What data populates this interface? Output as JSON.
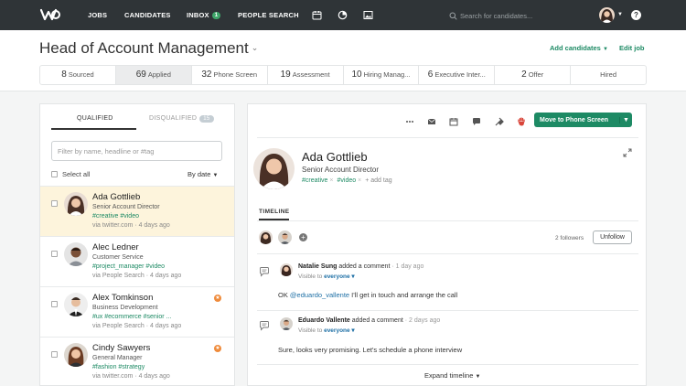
{
  "nav": {
    "items": [
      "JOBS",
      "CANDIDATES",
      "INBOX",
      "PEOPLE SEARCH"
    ],
    "inbox_count": "1",
    "search_placeholder": "Search for candidates..."
  },
  "header": {
    "job_title": "Head of Account Management",
    "add_candidates": "Add candidates",
    "edit_job": "Edit job",
    "stages": [
      {
        "count": "8",
        "label": "Sourced"
      },
      {
        "count": "69",
        "label": "Applied"
      },
      {
        "count": "32",
        "label": "Phone Screen"
      },
      {
        "count": "19",
        "label": "Assessment"
      },
      {
        "count": "10",
        "label": "Hiring Manag..."
      },
      {
        "count": "6",
        "label": "Executive Inter..."
      },
      {
        "count": "2",
        "label": "Offer"
      },
      {
        "count": "",
        "label": "Hired"
      }
    ]
  },
  "left": {
    "tab_qualified": "QUALIFIED",
    "tab_disqualified": "DISQUALIFIED",
    "disqualified_count": "15",
    "filter_placeholder": "Filter by name, headline or #tag",
    "select_all": "Select all",
    "sort": "By date",
    "candidates": [
      {
        "name": "Ada Gottlieb",
        "headline": "Senior Account Director",
        "tags": "#creative #video",
        "source": "via twitter.com · 4 days ago"
      },
      {
        "name": "Alec Ledner",
        "headline": "Customer Service",
        "tags": "#project_manager #video",
        "source": "via People Search · 4 days ago"
      },
      {
        "name": "Alex Tomkinson",
        "headline": "Business Development",
        "tags": "#ux #ecommerce #senior ...",
        "source": "via People Search · 4 days ago"
      },
      {
        "name": "Cindy Sawyers",
        "headline": "General Manager",
        "tags": "#fashion #strategy",
        "source": "via twitter.com · 4 days ago"
      }
    ]
  },
  "right": {
    "move_button": "Move to Phone Screen",
    "profile": {
      "name": "Ada Gottlieb",
      "title": "Senior Account Director",
      "tags": [
        "#creative",
        "#video"
      ],
      "add_tag": "+ add tag"
    },
    "timeline_label": "TIMELINE",
    "followers": "2 followers",
    "unfollow": "Unfollow",
    "comments": [
      {
        "author": "Natalie Sung",
        "action": " added a comment",
        "ago": " · 1 day ago",
        "visible_prefix": "Visible to ",
        "visible": "everyone",
        "mention": "@eduardo_vallente",
        "body_prefix": "OK ",
        "body": " I'll get in touch and arrange the call"
      },
      {
        "author": "Eduardo Vallente",
        "action": " added a comment",
        "ago": " · 2 days ago",
        "visible_prefix": "Visible to ",
        "visible": "everyone",
        "body": "Sure, looks very promising. Let's schedule a phone interview"
      }
    ],
    "expand_timeline": "Expand timeline"
  },
  "colors": {
    "nav_bg": "#2f3437",
    "accent": "#1d8a64",
    "active_row": "#fdf4dc",
    "star": "#ef8b3b"
  }
}
